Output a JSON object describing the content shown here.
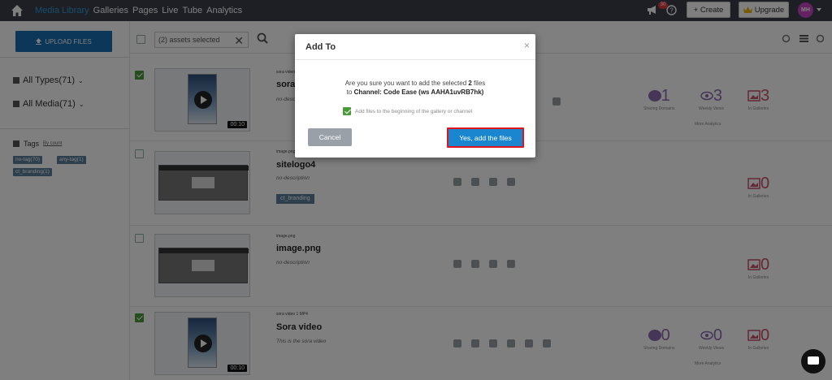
{
  "nav": {
    "links": [
      "Media Library",
      "Galleries",
      "Pages",
      "Live",
      "Tube",
      "Analytics"
    ],
    "notifications_count": "30",
    "create_label": "+ Create",
    "upgrade_label": "Upgrade",
    "avatar_initials": "MH"
  },
  "sidebar": {
    "upload_label": "UPLOAD FILES",
    "filter_types": "All Types(71)",
    "filter_media": "All Media(71)",
    "tags_title": "Tags",
    "tags_sort": "By count",
    "tags": [
      "no-tag(70)",
      "any-tag(1)",
      "ct_branding(1)"
    ]
  },
  "toolbar": {
    "selected_text": "(2) assets selected"
  },
  "items": [
    {
      "kind": "sora video 1",
      "title": "sora",
      "desc": "no-desc",
      "duration": "00:10",
      "checked": true,
      "stats": {
        "www": "1",
        "views": "3",
        "galleries": "3"
      },
      "stat_labels": {
        "www": "Sharing Domains",
        "views": "Weekly Views",
        "galleries": "In Galleries"
      },
      "more_analytics": "More Analytics"
    },
    {
      "kind": "image.png",
      "title": "sitelogo4",
      "desc": "no-description",
      "tag": "ct_branding",
      "checked": false,
      "stats": {
        "galleries": "0"
      },
      "stat_labels": {
        "galleries": "In Galleries"
      }
    },
    {
      "kind": "image.png",
      "title": "image.png",
      "desc": "no-description",
      "checked": false,
      "stats": {
        "galleries": "0"
      },
      "stat_labels": {
        "galleries": "In Galleries"
      }
    },
    {
      "kind": "sora video 1 MP4",
      "title": "Sora video",
      "desc": "This is the sora video",
      "duration": "00:10",
      "checked": true,
      "stats": {
        "www": "0",
        "views": "0",
        "galleries": "0"
      },
      "stat_labels": {
        "www": "Sharing Domains",
        "views": "Weekly Views",
        "galleries": "In Galleries"
      },
      "more_analytics": "More Analytics"
    }
  ],
  "modal": {
    "title": "Add To",
    "close": "×",
    "msg_line1_pre": "Are you sure you want to add the selected ",
    "msg_count": "2",
    "msg_line1_post": " files",
    "msg_line2_pre": "to ",
    "msg_target": "Channel: Code Ease (ws AAHA1uvRB7hk)",
    "checkbox_label": "Add files to the beginning of the gallery or channel",
    "cancel_label": "Cancel",
    "confirm_label": "Yes, add the files"
  },
  "colors": {
    "nav_bg": "#3a3f4b",
    "nav_active": "#2e9bd6",
    "primary": "#1a86d0",
    "highlight_border": "#e0141e",
    "stat_purple": "#8a6ab0",
    "stat_pink": "#c8526a",
    "check_green": "#4a9a3c"
  }
}
